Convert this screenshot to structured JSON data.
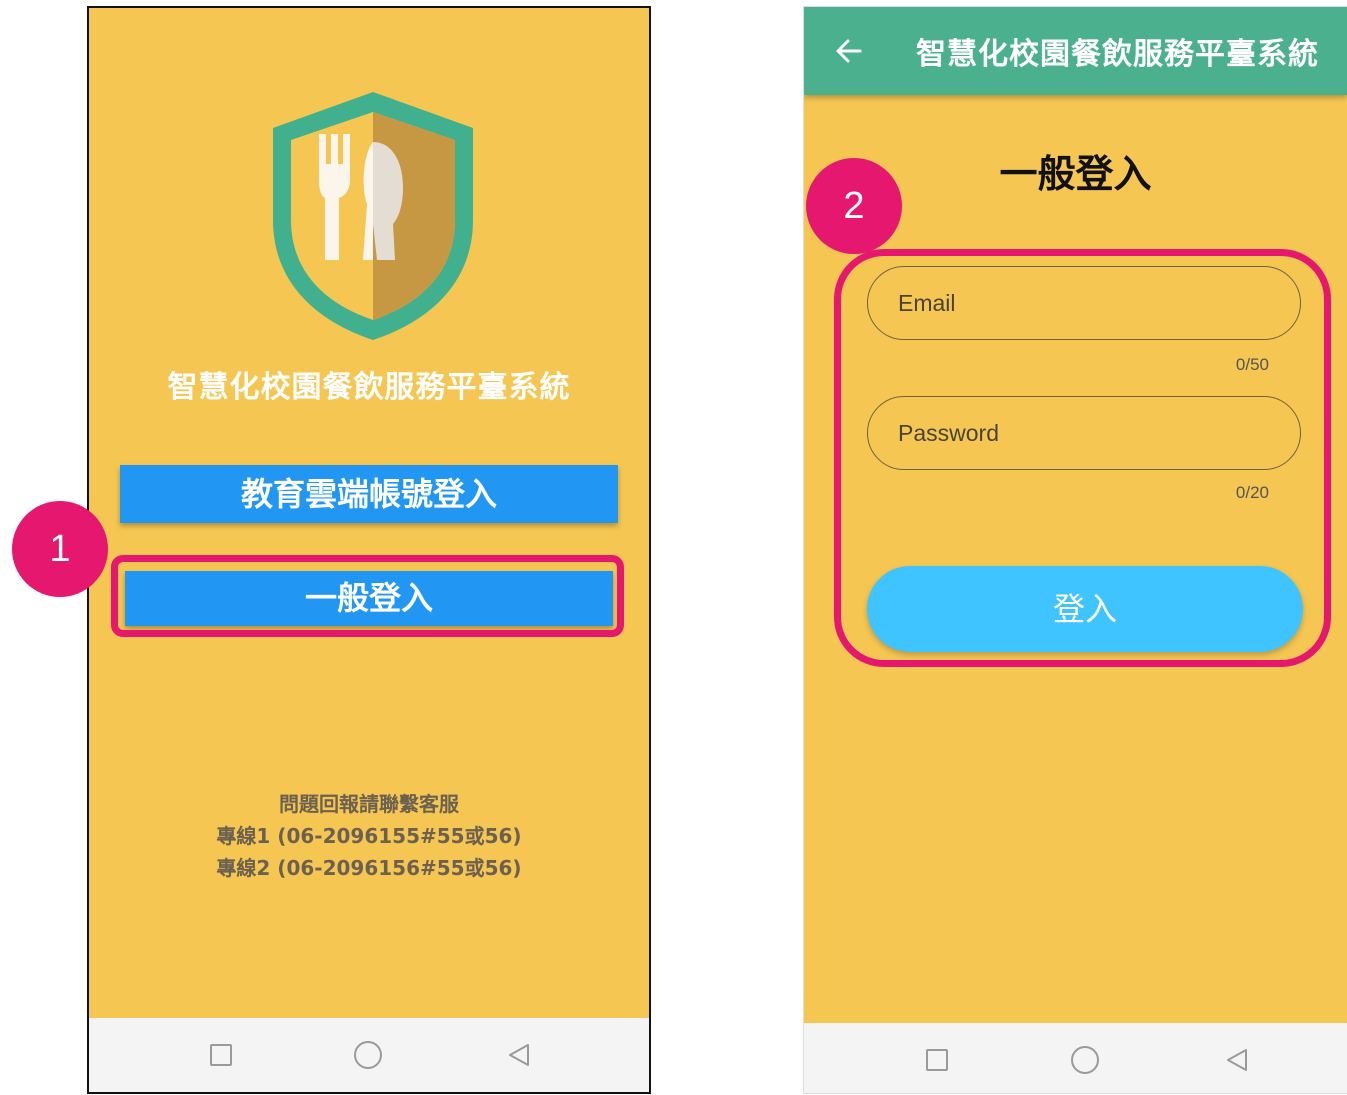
{
  "left_screen": {
    "app_name": "智慧化校園餐飲服務平臺系統",
    "cloud_login_label": "教育雲端帳號登入",
    "general_login_label": "一般登入",
    "contact": {
      "line0": "問題回報請聯繫客服",
      "line1": "專線1 (06-2096155#55或56)",
      "line2": "專線2 (06-2096156#55或56)"
    }
  },
  "right_screen": {
    "appbar_title": "智慧化校園餐飲服務平臺系統",
    "page_title": "一般登入",
    "email": {
      "placeholder": "Email",
      "value": "",
      "counter": "0/50"
    },
    "password": {
      "placeholder": "Password",
      "value": "",
      "counter": "0/20"
    },
    "login_label": "登入"
  },
  "annotations": {
    "marker_1": "1",
    "marker_2": "2"
  },
  "colors": {
    "background": "#f5c652",
    "appbar": "#4bb08e",
    "primary_button": "#2196f3",
    "login_button": "#40c4ff",
    "highlight": "#e6176f"
  },
  "icons": {
    "logo": "shield-fork-knife-logo",
    "back": "arrow-left-icon",
    "nav_recents": "square-icon",
    "nav_home": "circle-icon",
    "nav_back": "triangle-back-icon"
  }
}
